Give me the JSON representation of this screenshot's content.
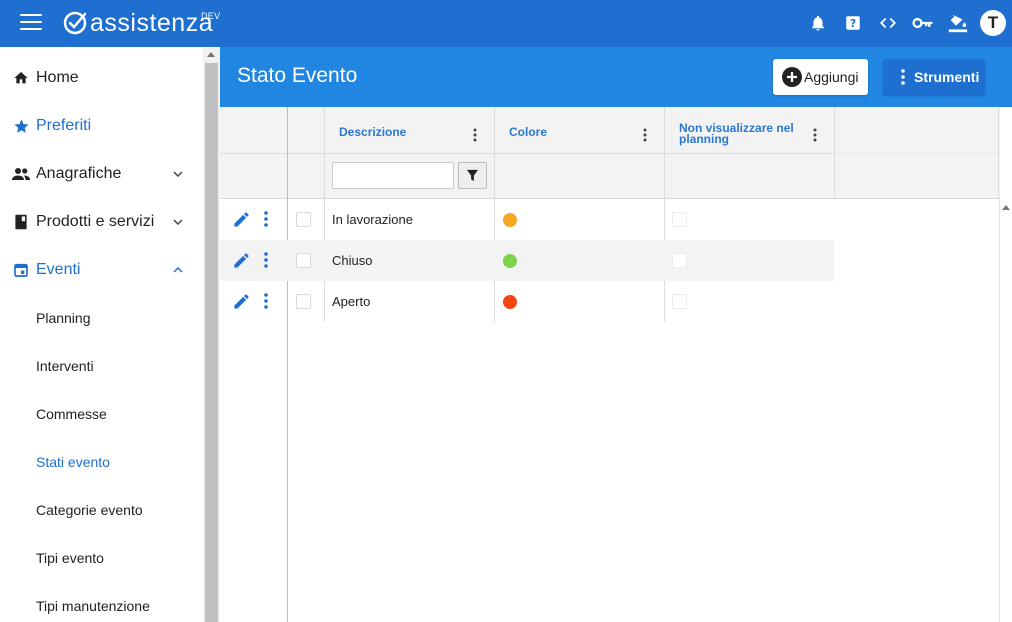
{
  "app": {
    "logo_text": "assistenza",
    "env_badge": "DEV",
    "user_initial": "T",
    "brand_color": "#1e6fd0",
    "header_color": "#2086e1"
  },
  "topbar": {
    "icons": [
      "bell-icon",
      "help-icon",
      "code-icon",
      "key-icon",
      "paint-bucket-icon"
    ]
  },
  "sidebar": {
    "items": [
      {
        "label": "Home",
        "icon": "home-icon"
      },
      {
        "label": "Preferiti",
        "icon": "star-icon"
      },
      {
        "label": "Anagrafiche",
        "icon": "people-icon"
      },
      {
        "label": "Prodotti e servizi",
        "icon": "book-icon"
      },
      {
        "label": "Eventi",
        "icon": "calendar-icon"
      }
    ],
    "sub_items": [
      {
        "label": "Planning"
      },
      {
        "label": "Interventi"
      },
      {
        "label": "Commesse"
      },
      {
        "label": "Stati evento"
      },
      {
        "label": "Categorie evento"
      },
      {
        "label": "Tipi evento"
      },
      {
        "label": "Tipi manutenzione"
      }
    ]
  },
  "page": {
    "title": "Stato Evento",
    "add_label": "Aggiungi",
    "tools_label": "Strumenti"
  },
  "grid": {
    "columns": [
      {
        "title": "Descrizione"
      },
      {
        "title": "Colore"
      },
      {
        "title_line1": "Non visualizzare nel",
        "title_line2": "planning"
      }
    ],
    "rows": [
      {
        "descrizione": "In lavorazione",
        "colore": "#f5a623",
        "non_visualizzare": false
      },
      {
        "descrizione": "Chiuso",
        "colore": "#7ed34b",
        "non_visualizzare": false
      },
      {
        "descrizione": "Aperto",
        "colore": "#f2470f",
        "non_visualizzare": false
      }
    ]
  }
}
